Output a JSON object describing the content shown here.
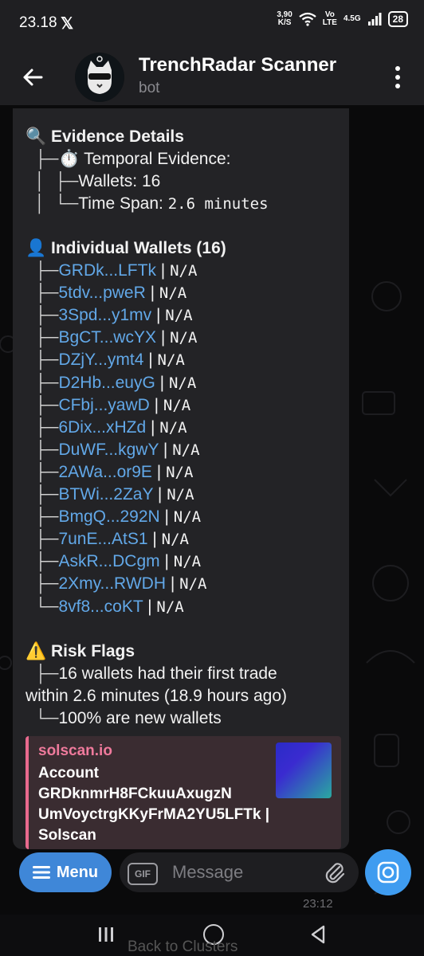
{
  "status": {
    "time": "23.18",
    "x_logo": "𝕏",
    "net_speed_value": "3,90",
    "net_speed_unit": "K/S",
    "volte": "Vo",
    "lte": "LTE",
    "network": "4.5G",
    "battery": "28"
  },
  "header": {
    "title": "TrenchRadar Scanner",
    "subtitle": "bot"
  },
  "message": {
    "evidence_title": "Evidence Details",
    "evidence_emoji": "🔍",
    "temporal_label": "Temporal Evidence:",
    "temporal_emoji": "⏱️",
    "wallets_label": "Wallets: 16",
    "time_span_label": "Time Span:",
    "time_span_value": "2.6 minutes",
    "wallets_title": "Individual Wallets (16)",
    "wallets_emoji": "👤",
    "wallets": [
      {
        "addr": "GRDk...LFTk",
        "val": "N/A"
      },
      {
        "addr": "5tdv...pweR",
        "val": "N/A"
      },
      {
        "addr": "3Spd...y1mv",
        "val": "N/A"
      },
      {
        "addr": "BgCT...wcYX",
        "val": "N/A"
      },
      {
        "addr": "DZjY...ymt4",
        "val": "N/A"
      },
      {
        "addr": "D2Hb...euyG",
        "val": "N/A"
      },
      {
        "addr": "CFbj...yawD",
        "val": "N/A"
      },
      {
        "addr": "6Dix...xHZd",
        "val": "N/A"
      },
      {
        "addr": "DuWF...kgwY",
        "val": "N/A"
      },
      {
        "addr": "2AWa...or9E",
        "val": "N/A"
      },
      {
        "addr": "BTWi...2ZaY",
        "val": "N/A"
      },
      {
        "addr": "BmgQ...292N",
        "val": "N/A"
      },
      {
        "addr": "7unE...AtS1",
        "val": "N/A"
      },
      {
        "addr": "AskR...DCgm",
        "val": "N/A"
      },
      {
        "addr": "2Xmy...RWDH",
        "val": "N/A"
      },
      {
        "addr": "8vf8...coKT",
        "val": "N/A"
      }
    ],
    "risk_title": "Risk Flags",
    "risk_emoji": "⚠️",
    "risk_line1": "16 wallets had their first trade",
    "risk_line2": "within 2.6 minutes (18.9 hours ago)",
    "risk_line3": "100% are new wallets"
  },
  "preview": {
    "site": "solscan.io",
    "line1": "Account",
    "line2": "GRDknmrH8FCkuuAxugzN",
    "line3": "UmVoyctrgKKyFrMA2YU5LFTk |",
    "line4": "Solscan"
  },
  "input": {
    "menu_label": "Menu",
    "gif_label": "GIF",
    "placeholder": "Message"
  },
  "timestamp": "23:12",
  "navbar": {
    "ghost_text": "Back to Clusters"
  }
}
